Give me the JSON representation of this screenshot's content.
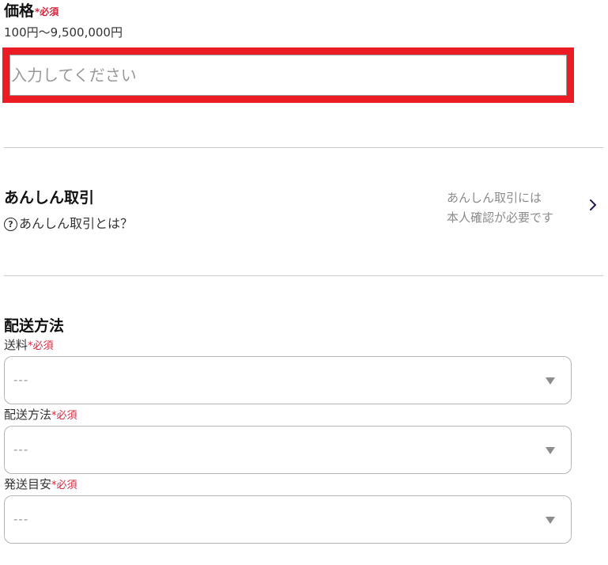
{
  "price": {
    "title": "価格",
    "required_mark": "*必須",
    "range": "100円〜9,500,000円",
    "placeholder": "入力してください",
    "value": ""
  },
  "safe_trade": {
    "title": "あんしん取引",
    "help_icon": "question-circle-icon",
    "help_link": "あんしん取引とは？",
    "note_line1": "あんしん取引には",
    "note_line2": "本人確認が必要です",
    "chevron_icon": "chevron-right-icon"
  },
  "shipping": {
    "title": "配送方法",
    "fields": [
      {
        "label": "送料",
        "required_mark": "*必須",
        "value": "---"
      },
      {
        "label": "配送方法",
        "required_mark": "*必須",
        "value": "---"
      },
      {
        "label": "発送目安",
        "required_mark": "*必須",
        "value": "---"
      }
    ]
  },
  "colors": {
    "required": "#d6263e",
    "highlight_border": "#ec1c24",
    "divider": "#cccccc",
    "muted_text": "#8a8a8a"
  }
}
